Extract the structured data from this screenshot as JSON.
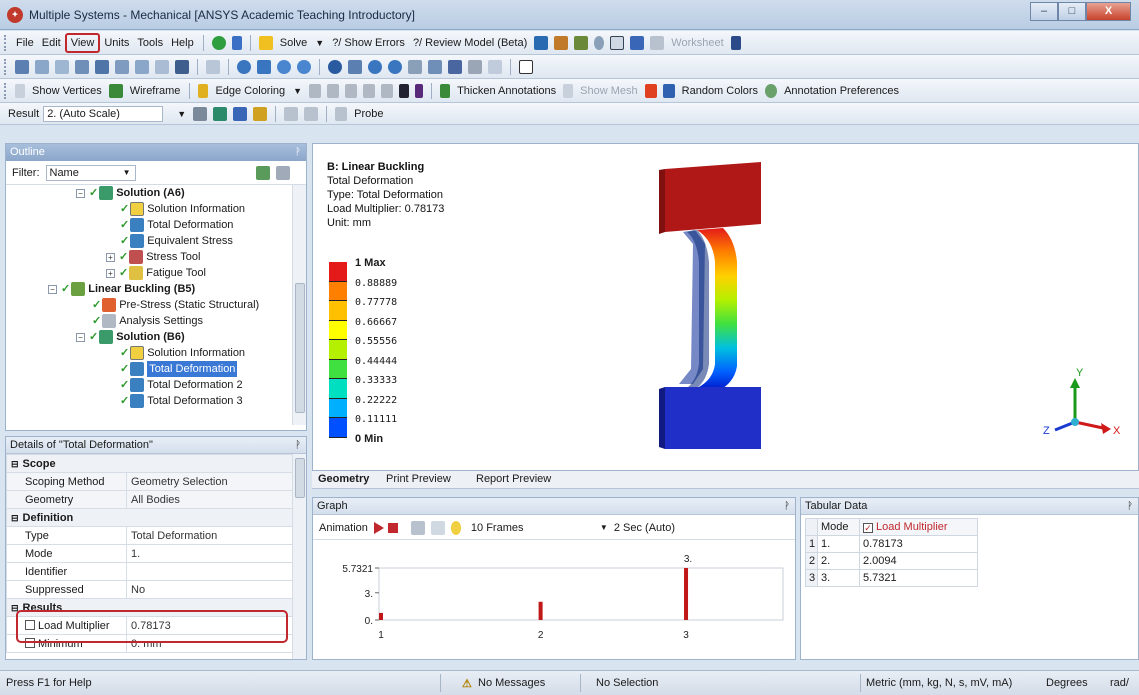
{
  "window": {
    "title": "Multiple Systems - Mechanical [ANSYS Academic Teaching Introductory]",
    "buttons": {
      "minimize": "–",
      "maximize": "□",
      "close": "X"
    }
  },
  "menu": {
    "file": "File",
    "edit": "Edit",
    "view": "View",
    "units": "Units",
    "tools": "Tools",
    "help": "Help",
    "solve": "Solve",
    "show_errors": "?/ Show Errors",
    "review_model": "?/ Review Model (Beta)",
    "worksheet": "Worksheet"
  },
  "toolbar3": {
    "show_vertices": "Show Vertices",
    "wireframe": "Wireframe",
    "edge_coloring": "Edge Coloring",
    "thicken_annotations": "Thicken Annotations",
    "show_mesh": "Show Mesh",
    "random_colors": "Random Colors",
    "annotation_preferences": "Annotation Preferences"
  },
  "toolbar4": {
    "result_label": "Result",
    "result_value": "2. (Auto Scale)",
    "probe": "Probe"
  },
  "outline": {
    "header": "Outline",
    "filter_label": "Filter:",
    "filter_value": "Name",
    "items": [
      {
        "label": "Solution (A6)",
        "bold": true
      },
      {
        "label": "Solution Information"
      },
      {
        "label": "Total Deformation"
      },
      {
        "label": "Equivalent Stress"
      },
      {
        "label": "Stress Tool"
      },
      {
        "label": "Fatigue Tool"
      },
      {
        "label": "Linear Buckling (B5)",
        "bold": true
      },
      {
        "label": "Pre-Stress (Static Structural)"
      },
      {
        "label": "Analysis Settings"
      },
      {
        "label": "Solution (B6)",
        "bold": true
      },
      {
        "label": "Solution Information"
      },
      {
        "label": "Total Deformation",
        "selected": true
      },
      {
        "label": "Total Deformation 2"
      },
      {
        "label": "Total Deformation 3"
      }
    ]
  },
  "details": {
    "header": "Details of \"Total Deformation\"",
    "groups": {
      "scope": "Scope",
      "definition": "Definition",
      "results": "Results"
    },
    "rows": {
      "scoping_method": {
        "k": "Scoping Method",
        "v": "Geometry Selection"
      },
      "geometry": {
        "k": "Geometry",
        "v": "All Bodies"
      },
      "type": {
        "k": "Type",
        "v": "Total Deformation"
      },
      "mode": {
        "k": "Mode",
        "v": "1."
      },
      "identifier": {
        "k": "Identifier",
        "v": ""
      },
      "suppressed": {
        "k": "Suppressed",
        "v": "No"
      },
      "load_multiplier": {
        "k": "Load Multiplier",
        "v": "0.78173"
      },
      "minimum": {
        "k": "Minimum",
        "v": "0. mm"
      }
    }
  },
  "viewport": {
    "title": "B: Linear Buckling",
    "line2": "Total Deformation",
    "line3": "Type: Total Deformation",
    "line4": "Load Multiplier: 0.78173",
    "line5": "Unit: mm",
    "legend_labels": [
      "1 Max",
      "0.88889",
      "0.77778",
      "0.66667",
      "0.55556",
      "0.44444",
      "0.33333",
      "0.22222",
      "0.11111",
      "0 Min"
    ],
    "legend_colors": [
      "#e41a1a",
      "#ff8000",
      "#ffc000",
      "#ffff00",
      "#b4f000",
      "#40e040",
      "#00e0c0",
      "#00b0ff",
      "#0050ff",
      "#0000d0"
    ],
    "axes": {
      "x": "X",
      "y": "Y",
      "z": "Z"
    }
  },
  "view_tabs": {
    "geometry": "Geometry",
    "print_preview": "Print Preview",
    "report_preview": "Report Preview"
  },
  "graph": {
    "header": "Graph",
    "animation": "Animation",
    "frames": "10 Frames",
    "duration": "2 Sec (Auto)",
    "y_max_label": "5.7321",
    "y_mid_label": "3.",
    "y_zero_label": "0.",
    "top_label": "3.",
    "x_labels": [
      "1",
      "2",
      "3"
    ]
  },
  "chart_data": {
    "type": "bar",
    "categories": [
      "1",
      "2",
      "3"
    ],
    "values": [
      0.78173,
      2.0094,
      5.7321
    ],
    "ylim": [
      0,
      5.7321
    ]
  },
  "tabular": {
    "header": "Tabular Data",
    "col_mode": "Mode",
    "col_lm": "Load Multiplier",
    "rows": [
      {
        "n": "1",
        "mode": "1.",
        "lm": "0.78173"
      },
      {
        "n": "2",
        "mode": "2.",
        "lm": "2.0094"
      },
      {
        "n": "3",
        "mode": "3.",
        "lm": "5.7321"
      }
    ]
  },
  "status": {
    "help": "Press F1 for Help",
    "messages": "No Messages",
    "selection": "No Selection",
    "units": "Metric (mm, kg, N, s, mV, mA)",
    "degrees": "Degrees",
    "rad": "rad/"
  }
}
